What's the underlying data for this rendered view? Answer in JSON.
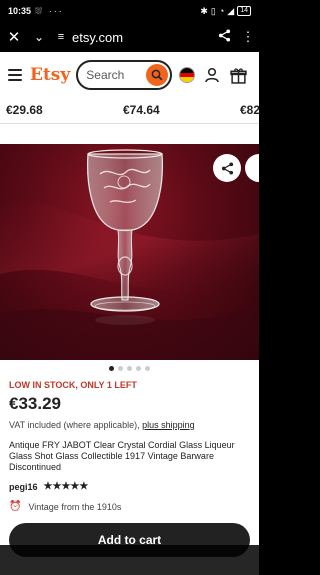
{
  "status": {
    "time": "10:35",
    "left_icons": "⛆ ···",
    "battery": "14"
  },
  "browser": {
    "url": "etsy.com"
  },
  "header": {
    "logo": "Etsy",
    "search_placeholder": "Search"
  },
  "recommended_prices": [
    "€29.68",
    "€74.64",
    "€82"
  ],
  "listing": {
    "stock": "LOW IN STOCK, ONLY 1 LEFT",
    "price": "€33.29",
    "vat_text": "VAT included (where applicable), ",
    "vat_link": "plus shipping",
    "title": "Antique FRY JABOT Clear Crystal Cordial Glass Liqueur Glass Shot Glass Collectible 1917 Vintage Barware Discontinued",
    "seller": "pegi16",
    "rating": 5,
    "stars": "★★★★★",
    "vintage_note": "Vintage from the 1910s",
    "add_to_cart": "Add to cart",
    "image_dots": {
      "total": 5,
      "active": 0
    }
  },
  "colors": {
    "brand": "#f1641e",
    "stock_alert": "#c0392b",
    "button": "#222222"
  }
}
